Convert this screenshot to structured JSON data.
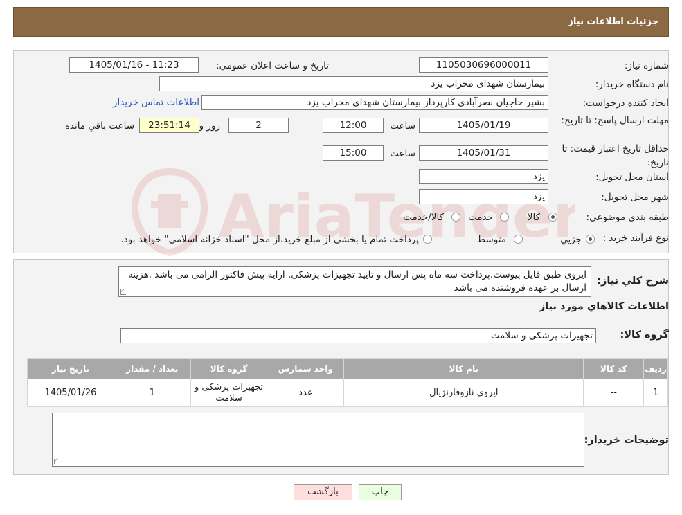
{
  "header": {
    "title": "جزئیات اطلاعات نیاز"
  },
  "watermark": {
    "text": "AriaTender.neT"
  },
  "form": {
    "need_number_label": "شماره نیاز:",
    "need_number": "1105030696000011",
    "announce_label": "تاریخ و ساعت اعلان عمومي:",
    "announce_value": "1405/01/16 - 11:23",
    "buyer_label": "نام دستگاه خريدار:",
    "buyer_value": "بیمارستان شهدای محراب یزد",
    "creator_label": "ايجاد کننده درخواست:",
    "creator_value": "بشیر حاجیان نصرآبادی کارپرداز بیمارستان شهدای محراب یزد",
    "contact_link": "اطلاعات تماس خريدار",
    "deadline_label": "مهلت ارسال پاسخ: تا تاريخ:",
    "deadline_date": "1405/01/19",
    "time_label": "ساعت",
    "deadline_time": "12:00",
    "days_value": "2",
    "days_label": "روز و",
    "remaining_value": "23:51:14",
    "remaining_label": "ساعت باقي مانده",
    "validity_label": "حداقل تاريخ اعتبار قيمت: تا تاريخ:",
    "validity_date": "1405/01/31",
    "validity_time": "15:00",
    "province_label": "استان محل تحويل:",
    "province_value": "یزد",
    "city_label": "شهر محل تحويل:",
    "city_value": "یزد",
    "category_label": "طبقه بندی موضوعی:",
    "category_options": [
      "کالا",
      "خدمت",
      "کالا/خدمت"
    ],
    "category_selected": "کالا",
    "process_label": "نوع فرآيند خريد :",
    "process_options": [
      "جزيي",
      "متوسط"
    ],
    "process_selected": "جزيي",
    "process_note": "پرداخت تمام یا بخشی از مبلغ خرید،از محل \"اسناد خزانه اسلامی\" خواهد بود."
  },
  "description": {
    "label": "شرح کلي نياز:",
    "text": "ایروی طبق فایل پیوست.پرداخت سه ماه پس ارسال و تایید تجهیزات پزشکی. ارایه پیش فاکتور الزامی می باشد .هزینه ارسال بر عهده فروشنده می باشد"
  },
  "items_section": {
    "title": "اطلاعات کالاهاي مورد نياز",
    "group_label": "گروه کالا:",
    "group_value": "تجهیزات پزشکی و سلامت"
  },
  "table": {
    "headers": [
      "رديف",
      "کد کالا",
      "نام کالا",
      "واحد شمارش",
      "گروه کالا",
      "تعداد / مقدار",
      "تاريخ نياز"
    ],
    "rows": [
      [
        "1",
        "--",
        "ایروی نازوفارنژیال",
        "عدد",
        "تجهیزات پزشکی و سلامت",
        "1",
        "1405/01/26"
      ]
    ]
  },
  "buyer_notes": {
    "label": "توضیحات خریدار:",
    "text": ""
  },
  "buttons": {
    "print": "چاپ",
    "back": "بازگشت"
  },
  "colors": {
    "header_bg": "#8b6a43",
    "table_header_bg": "#a8a8a8",
    "print_bg": "#eaffdf",
    "back_bg": "#ffdede"
  }
}
